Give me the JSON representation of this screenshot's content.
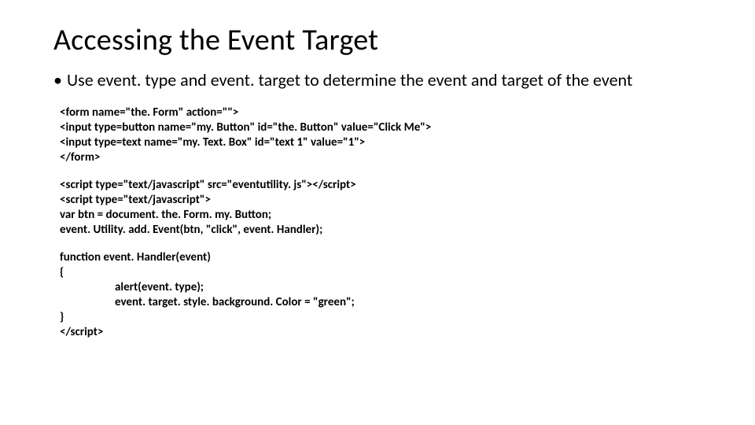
{
  "title": "Accessing the Event Target",
  "bullet": "Use event. type and event. target to determine the event and target of the event",
  "code1": "<form name=\"the. Form\" action=\"\">\n<input type=button name=\"my. Button\" id=\"the. Button\" value=\"Click Me\">\n<input type=text name=\"my. Text. Box\" id=\"text 1\" value=\"1\">\n</form>",
  "code2": "<script type=\"text/javascript\" src=\"eventutility. js\"></script>\n<script type=\"text/javascript\">\nvar btn = document. the. Form. my. Button;\nevent. Utility. add. Event(btn, \"click\", event. Handler);",
  "code3_l1": "function event. Handler(event)",
  "code3_l2": "{",
  "code3_l3": "alert(event. type);",
  "code3_l4": "event. target. style. background. Color = \"green\";",
  "code3_l5": "}",
  "code3_l6": "</script>"
}
